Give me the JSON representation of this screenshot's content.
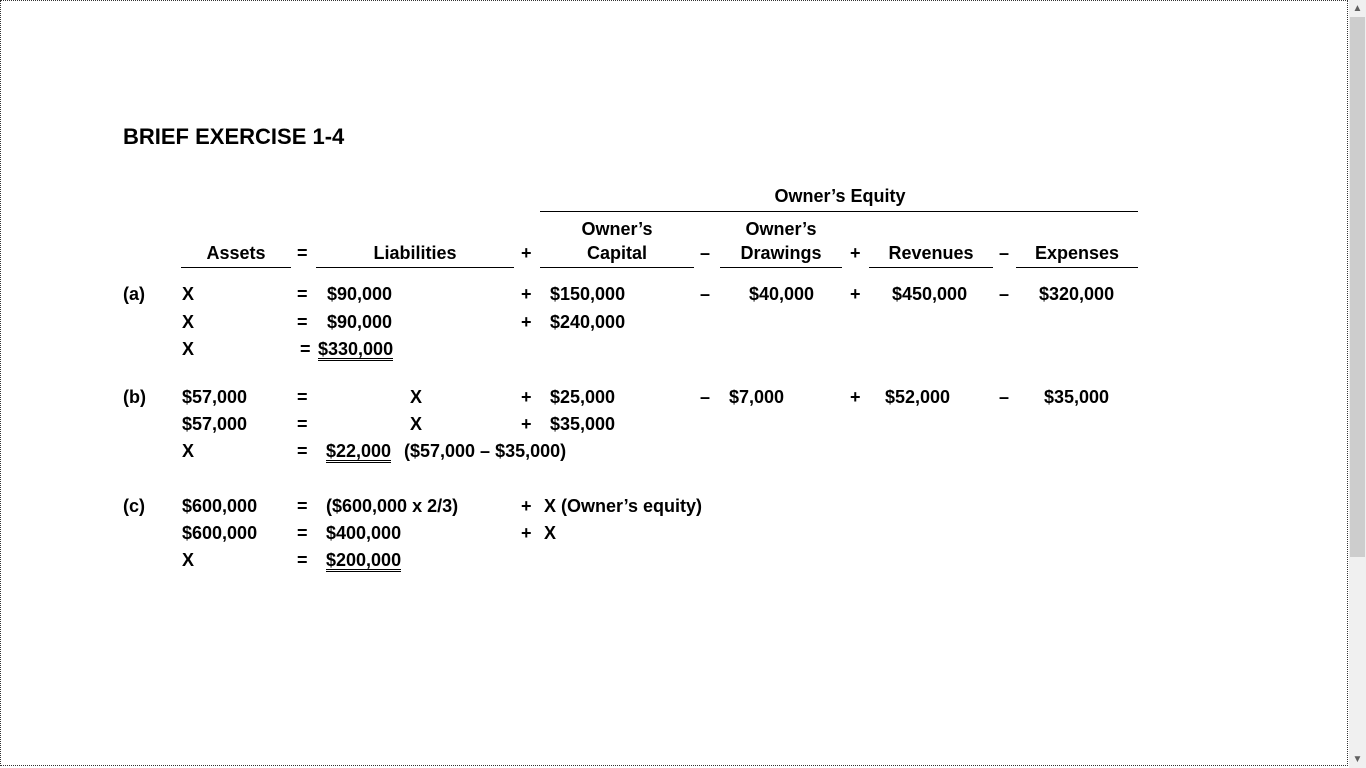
{
  "title": "BRIEF EXERCISE 1-4",
  "header": {
    "owners_equity": "Owner’s Equity",
    "assets": "Assets",
    "eq": "=",
    "liabilities": "Liabilities",
    "plus": "+",
    "minus": "–",
    "capital_line1": "Owner’s",
    "capital_line2": "Capital",
    "drawings_line1": "Owner’s",
    "drawings_line2": "Drawings",
    "revenues": "Revenues",
    "expenses": "Expenses"
  },
  "a": {
    "label": "(a)",
    "r1": {
      "assets": "X",
      "eq": "=",
      "liab": "$90,000",
      "plus": "+",
      "capital": "$150,000",
      "minus1": "–",
      "drawings": "$40,000",
      "plus2": "+",
      "revenues": "$450,000",
      "minus2": "–",
      "expenses": "$320,000"
    },
    "r2": {
      "assets": "X",
      "eq": "=",
      "liab": "$90,000",
      "plus": "+",
      "capital": "$240,000"
    },
    "r3": {
      "assets": "X",
      "eq": "=",
      "liab": "$330,000"
    }
  },
  "b": {
    "label": "(b)",
    "r1": {
      "assets": "$57,000",
      "eq": "=",
      "liab": "X",
      "plus": "+",
      "capital": "$25,000",
      "minus1": "–",
      "drawings": "$7,000",
      "plus2": "+",
      "revenues": "$52,000",
      "minus2": "–",
      "expenses": "$35,000"
    },
    "r2": {
      "assets": "$57,000",
      "eq": "=",
      "liab": "X",
      "plus": "+",
      "capital": "$35,000"
    },
    "r3": {
      "assets": "X",
      "eq": "=",
      "liab": "$22,000",
      "note": "($57,000 – $35,000)"
    }
  },
  "c": {
    "label": "(c)",
    "r1": {
      "assets": "$600,000",
      "eq": "=",
      "liab": "($600,000 x 2/3)",
      "plus": "+",
      "equity": "X (Owner’s equity)"
    },
    "r2": {
      "assets": "$600,000",
      "eq": "=",
      "liab": "$400,000",
      "plus": "+",
      "equity": "X"
    },
    "r3": {
      "assets": "X",
      "eq": "=",
      "liab": "$200,000"
    }
  }
}
